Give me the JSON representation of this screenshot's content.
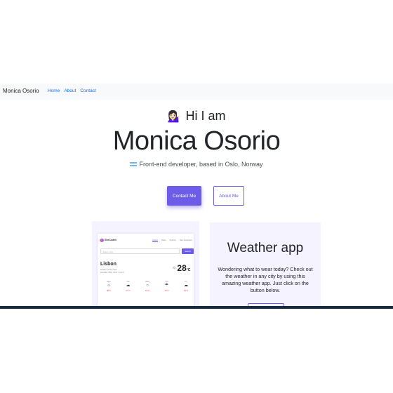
{
  "navbar": {
    "brand": "Monica Osorio",
    "links": [
      "Home",
      "About",
      "Contact"
    ]
  },
  "hero": {
    "greeting": "Hi I am",
    "greeting_emoji": "💁🏻‍♀️",
    "name": "Monica Osorio",
    "subtitle": "Front-end developer, based in Oslo, Norway",
    "contact_button": "Contact Me",
    "about_button": "About Me"
  },
  "project": {
    "title": "Weather app",
    "description": "Wondering what to wear today? Check out the weather in any city by using this amazing weather app. Just click on the button below.",
    "screenshot": {
      "logo_text": "SheCodes",
      "nav": [
        "Lisbon",
        "Paris",
        "Sydney",
        "San Francisco"
      ],
      "search_placeholder": "Enter a city",
      "search_button": "Search",
      "city": "Lisbon",
      "meta_line1": "Sunday 14:30, Clear",
      "meta_line2": "Humidity: 88%, Wind: 4 km/h",
      "temperature": "28",
      "unit": "°C",
      "forecast": [
        {
          "day": "Mon",
          "icon": "☼",
          "temp": "28°C"
        },
        {
          "day": "Tue",
          "icon": "☁",
          "temp": "27°C"
        },
        {
          "day": "Wed",
          "icon": "○",
          "temp": "24°C"
        },
        {
          "day": "Thu",
          "icon": "☂",
          "temp": "19°C"
        },
        {
          "day": "Fri",
          "icon": "☁",
          "temp": "23°C"
        }
      ]
    }
  },
  "colors": {
    "accent": "#6c5ce7",
    "link": "#0d6efd",
    "card_bg": "#f5f3ff",
    "navbar_bg": "#f8f9fa",
    "bottom_bar": "#17293f"
  }
}
